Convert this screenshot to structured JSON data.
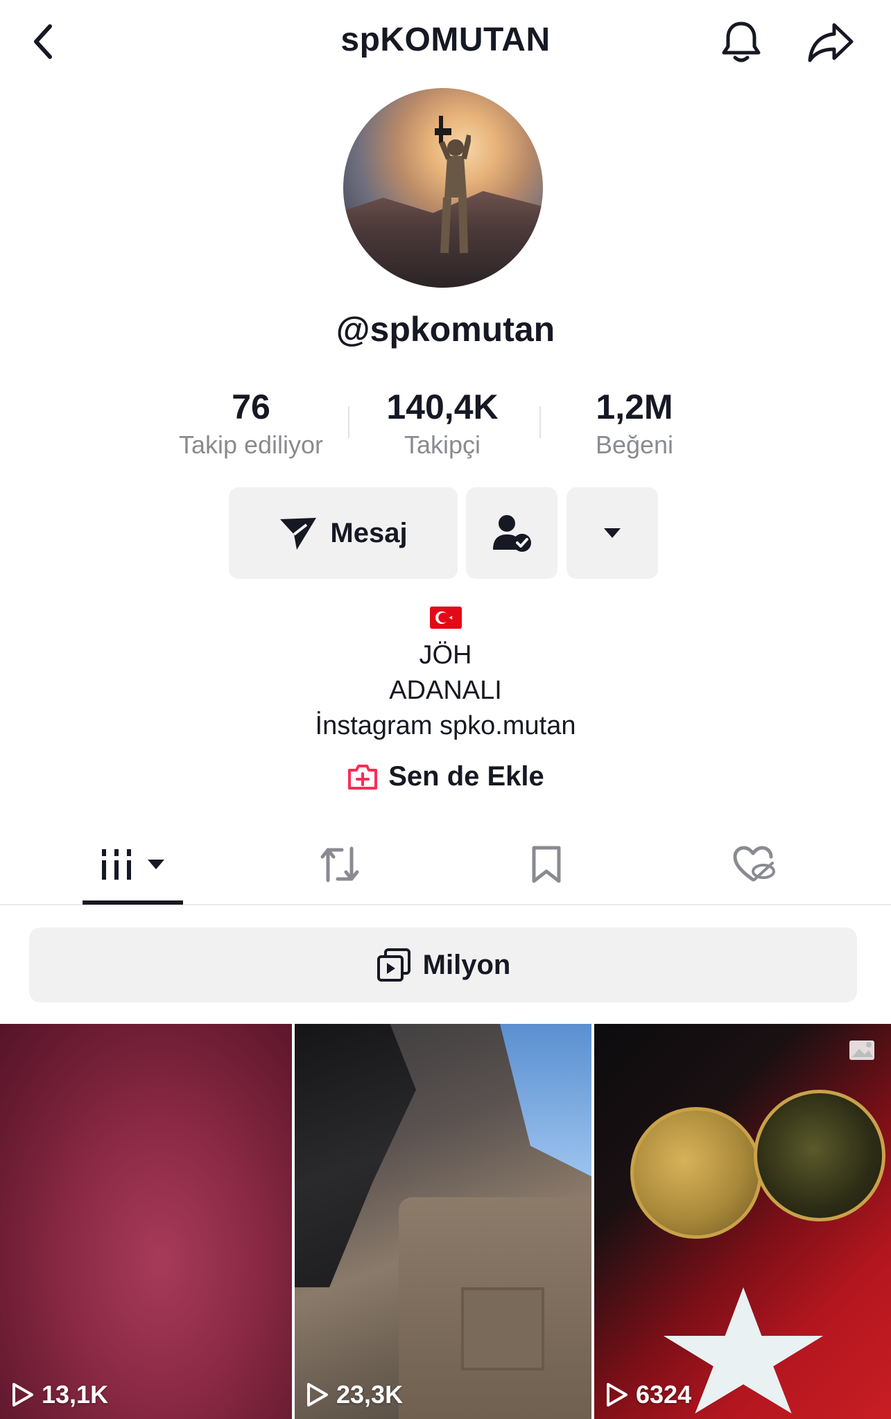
{
  "header": {
    "title": "spKOMUTAN"
  },
  "profile": {
    "handle": "@spkomutan"
  },
  "stats": {
    "following": {
      "value": "76",
      "label": "Takip ediliyor"
    },
    "followers": {
      "value": "140,4K",
      "label": "Takipçi"
    },
    "likes": {
      "value": "1,2M",
      "label": "Beğeni"
    }
  },
  "actions": {
    "message_label": "Mesaj"
  },
  "bio": {
    "lines": [
      "JÖH",
      "ADANALI",
      "İnstagram spko.mutan"
    ]
  },
  "add": {
    "label": "Sen de Ekle"
  },
  "playlist": {
    "label": "Milyon"
  },
  "videos": [
    {
      "views": "13,1K"
    },
    {
      "views": "23,3K"
    },
    {
      "views": "6324"
    }
  ],
  "colors": {
    "accent": "#fe2c55",
    "text": "#161823",
    "muted": "#8a8b91",
    "button_bg": "#f1f1f2"
  }
}
